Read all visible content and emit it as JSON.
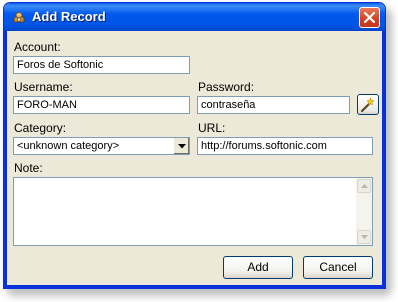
{
  "window": {
    "title": "Add Record"
  },
  "form": {
    "account": {
      "label": "Account:",
      "value": "Foros de Softonic"
    },
    "username": {
      "label": "Username:",
      "value": "FORO-MAN"
    },
    "password": {
      "label": "Password:",
      "value": "contraseña"
    },
    "category": {
      "label": "Category:",
      "value": "<unknown category>"
    },
    "url": {
      "label": "URL:",
      "value": "http://forums.softonic.com"
    },
    "note": {
      "label": "Note:",
      "value": ""
    }
  },
  "buttons": {
    "add": "Add",
    "cancel": "Cancel"
  },
  "icons": {
    "app": "app-icon",
    "close": "close-icon",
    "password_generator": "magic-wand-icon",
    "dropdown": "chevron-down-icon",
    "scroll_up": "scroll-up-icon",
    "scroll_down": "scroll-down-icon"
  },
  "colors": {
    "titlebar": "#0058ee",
    "window_bg": "#ece9d8",
    "field_border": "#7f9db9",
    "close_button": "#d3421f"
  }
}
